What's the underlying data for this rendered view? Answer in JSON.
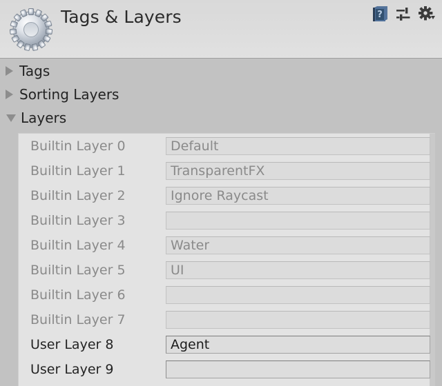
{
  "window": {
    "title": "Tags & Layers",
    "app_icon": "gear-settings-icon"
  },
  "header_icons": [
    {
      "name": "help-book-icon",
      "label": "?"
    },
    {
      "name": "preset-sliders-icon",
      "label": ""
    },
    {
      "name": "settings-gear-dropdown-icon",
      "label": ""
    }
  ],
  "foldouts": [
    {
      "label": "Tags",
      "expanded": false,
      "arrow": "triangle-right"
    },
    {
      "label": "Sorting Layers",
      "expanded": false,
      "arrow": "triangle-right"
    },
    {
      "label": "Layers",
      "expanded": true,
      "arrow": "triangle-down"
    }
  ],
  "layers": {
    "rows": [
      {
        "label": "Builtin Layer 0",
        "value": "Default",
        "placeholder": "",
        "editable": false
      },
      {
        "label": "Builtin Layer 1",
        "value": "TransparentFX",
        "placeholder": "",
        "editable": false
      },
      {
        "label": "Builtin Layer 2",
        "value": "Ignore Raycast",
        "placeholder": "",
        "editable": false
      },
      {
        "label": "Builtin Layer 3",
        "value": "",
        "placeholder": "",
        "editable": false
      },
      {
        "label": "Builtin Layer 4",
        "value": "Water",
        "placeholder": "",
        "editable": false
      },
      {
        "label": "Builtin Layer 5",
        "value": "UI",
        "placeholder": "",
        "editable": false
      },
      {
        "label": "Builtin Layer 6",
        "value": "",
        "placeholder": "",
        "editable": false
      },
      {
        "label": "Builtin Layer 7",
        "value": "",
        "placeholder": "",
        "editable": false
      },
      {
        "label": "User Layer 8",
        "value": "Agent",
        "placeholder": "",
        "editable": true
      },
      {
        "label": "User Layer 9",
        "value": "",
        "placeholder": "",
        "editable": true
      }
    ]
  },
  "colors": {
    "header_top": "#d9d9d9",
    "header_bottom": "#e1e1e1",
    "body": "#c2c2c2",
    "panel": "#e3e3e3",
    "field": "#dcdcdc",
    "text": "#232323",
    "text_disabled": "#8a8a8a",
    "arrow": "#8d8d8d"
  }
}
